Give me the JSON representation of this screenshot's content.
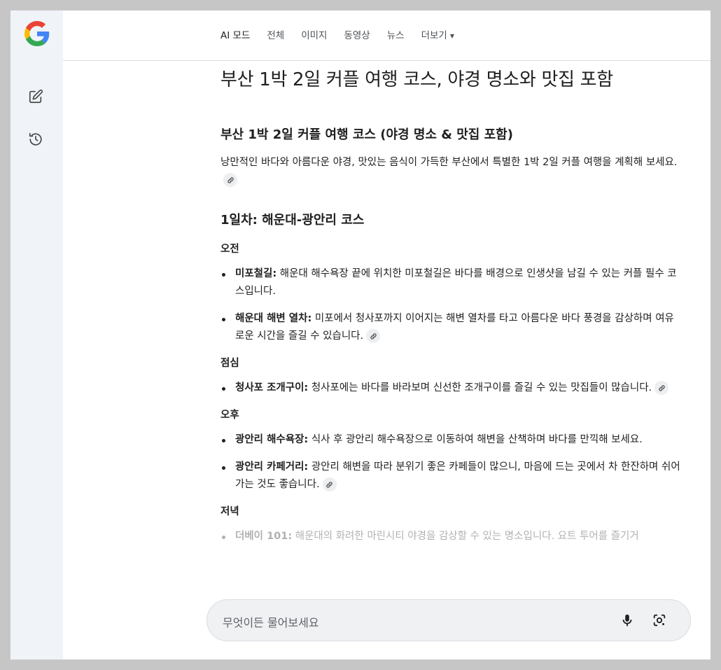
{
  "nav": {
    "tabs": [
      {
        "label": "AI 모드"
      },
      {
        "label": "전체"
      },
      {
        "label": "이미지"
      },
      {
        "label": "동영상"
      },
      {
        "label": "뉴스"
      },
      {
        "label": "더보기"
      }
    ]
  },
  "article": {
    "title": "부산 1박 2일 커플 여행 코스, 야경 명소와 맛집 포함",
    "subtitle": "부산 1박 2일 커플 여행 코스 (야경 명소 & 맛집 포함)",
    "intro": "낭만적인 바다와 아름다운 야경, 맛있는 음식이 가득한 부산에서 특별한 1박 2일 커플 여행을 계획해 보세요.",
    "day1": {
      "heading": "1일차: 해운대-광안리 코스",
      "morning": {
        "heading": "오전",
        "items": [
          {
            "name": "미포철길:",
            "text": " 해운대 해수욕장 끝에 위치한 미포철길은 바다를 배경으로 인생샷을 남길 수 있는 커플 필수 코스입니다."
          },
          {
            "name": "해운대 해변 열차:",
            "text": " 미포에서 청사포까지 이어지는 해변 열차를 타고 아름다운 바다 풍경을 감상하며 여유로운 시간을 즐길 수 있습니다."
          }
        ]
      },
      "lunch": {
        "heading": "점심",
        "items": [
          {
            "name": "청사포 조개구이:",
            "text": " 청사포에는 바다를 바라보며 신선한 조개구이를 즐길 수 있는 맛집들이 많습니다."
          }
        ]
      },
      "afternoon": {
        "heading": "오후",
        "items": [
          {
            "name": "광안리 해수욕장:",
            "text": " 식사 후 광안리 해수욕장으로 이동하여 해변을 산책하며 바다를 만끽해 보세요."
          },
          {
            "name": "광안리 카페거리:",
            "text": " 광안리 해변을 따라 분위기 좋은 카페들이 많으니, 마음에 드는 곳에서 차 한잔하며 쉬어가는 것도 좋습니다."
          }
        ]
      },
      "evening": {
        "heading": "저녁",
        "items": [
          {
            "name": "더베이 101:",
            "text": " 해운대의 화려한 마린시티 야경을 감상할 수 있는 명소입니다. 요트 투어를 즐기거"
          }
        ]
      }
    }
  },
  "search": {
    "placeholder": "무엇이든 물어보세요"
  },
  "icons": {
    "logo": "google-g-logo",
    "new_chat": "edit-square-icon",
    "history": "history-icon",
    "link": "link-icon",
    "mic": "mic-icon",
    "lens": "google-lens-icon"
  },
  "colors": {
    "sidebar_bg": "#f0f4f9",
    "searchbox_bg": "#f0f1f3",
    "text": "#1f1f1f",
    "muted": "#4d5156"
  }
}
